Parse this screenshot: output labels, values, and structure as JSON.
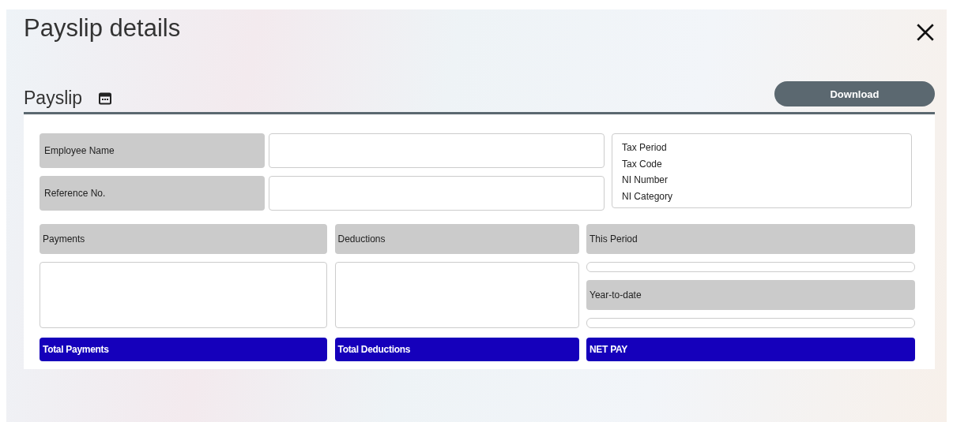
{
  "dialog": {
    "title": "Payslip details"
  },
  "section": {
    "title": "Payslip",
    "download_button": "Download"
  },
  "employee_fields": [
    {
      "label": "Employee Name"
    },
    {
      "label": "Reference No."
    }
  ],
  "tax_info": [
    "Tax Period",
    "Tax Code",
    "NI Number",
    "NI Category"
  ],
  "columns": [
    {
      "heading": "Payments",
      "total": "Total Payments"
    },
    {
      "heading": "Deductions",
      "total": "Total Deductions"
    }
  ],
  "summary": {
    "this_period": "This Period",
    "year_to_date": "Year-to-date",
    "net_pay": "NET PAY"
  }
}
